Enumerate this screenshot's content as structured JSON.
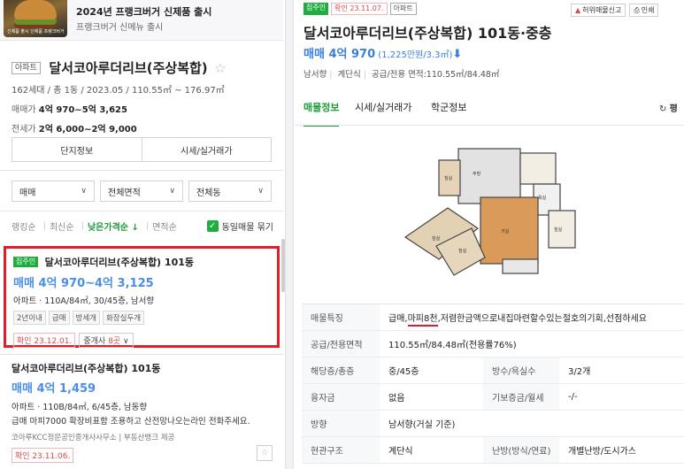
{
  "ad": {
    "thumb_caption": "신제품 출시 신제품 프랭크버거 신메뉴",
    "title": "2024년 프랭크버거 신제품 출시",
    "subtitle": "프랭크버거 신메뉴 출시"
  },
  "complex": {
    "type_tag": "아파트",
    "name": "달서코아루더리브(주상복합)",
    "meta": "162세대 / 총 1동 / 2023.05 / 110.55㎡ ~ 176.97㎡",
    "sale_label": "매매가",
    "sale_value": "4억 970~5억 3,625",
    "jeonse_label": "전세가",
    "jeonse_value": "2억 6,000~2억 9,000",
    "buttons": [
      "단지정보",
      "시세/실거래가"
    ]
  },
  "filters": [
    "매매",
    "전체면적",
    "전체동"
  ],
  "sort": {
    "options": [
      "랭킹순",
      "최신순",
      "낮은가격순 ↓",
      "면적순"
    ],
    "active_index": 2,
    "group_label": "동일매물 묶기",
    "group_checked": true
  },
  "listing1": {
    "badge": "집주인",
    "title": "달서코아루더리브(주상복합) 101동",
    "price": "매매 4억 970~4억 3,125",
    "desc": "아파트 · 110A/84㎡, 30/45층, 남서향",
    "chips": [
      "2년이내",
      "급매",
      "방세개",
      "화장실두개"
    ],
    "verified": "확인 23.12.01.",
    "agents_prefix": "중개사 ",
    "agents_count": "8곳"
  },
  "listing2": {
    "title": "달서코아루더리브(주상복합) 101동",
    "price": "매매 4억 1,459",
    "desc": "아파트 · 110B/84㎡, 6/45층, 남동향",
    "desc2": "급매 마피7000 확장비표함 조용하고 산전망나오는라인 전화주세요.",
    "agency": "코아루KCC정문공인중개사사무소 | 부동산뱅크 제공",
    "verified": "확인 23.11.06."
  },
  "detail": {
    "badge": "집주인",
    "verified": "확인 23.11.07.",
    "type_tag": "아파트",
    "tools": [
      "허위매물신고",
      "인쇄"
    ],
    "title": "달서코아루더리브(주상복합) 101동·중층",
    "price": "매매 4억 970",
    "price_unit": " (1,225만원/3.3㎡)",
    "meta": [
      "남서향",
      "계단식",
      "공급/전용 면적:110.55㎡/84.48㎡"
    ],
    "tabs": [
      "매물정보",
      "시세/실거래가",
      "학군정보"
    ],
    "refresh_label": "평",
    "feature_pre": "급매,",
    "feature_hl": "마피8천",
    "feature_post": ",저렴한금액으로내집마련할수있는절호의기회,선점하세요",
    "rows": [
      {
        "k": "매물특징"
      },
      {
        "k": "공급/전용면적",
        "v": "110.55㎡/84.48㎡(전용률76%)"
      },
      {
        "k": "해당층/총층",
        "v": "중/45층",
        "k2": "방수/욕실수",
        "v2": "3/2개"
      },
      {
        "k": "융자금",
        "v": "없음",
        "k2": "기보증금/월세",
        "v2": "-/-"
      },
      {
        "k": "방향",
        "v": "남서향(거실 기준)"
      },
      {
        "k": "현관구조",
        "v": "계단식",
        "k2": "난방(방식/연료)",
        "v2": "개별난방/도시가스"
      }
    ]
  },
  "colors": {
    "accent_green": "#1c9c3a",
    "price_blue": "#3a7ee0",
    "highlight_red": "#e01e2a"
  }
}
